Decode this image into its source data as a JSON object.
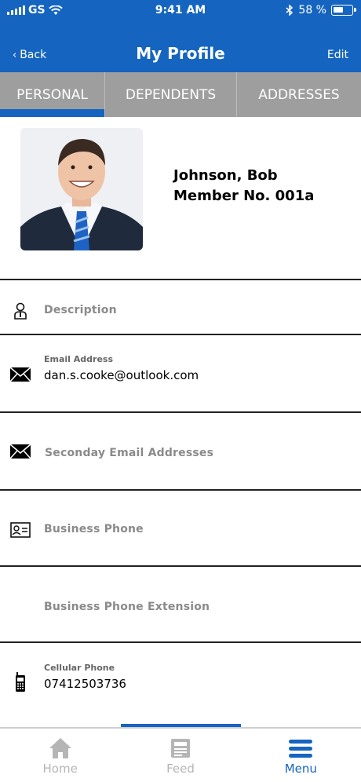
{
  "status_bar": {
    "carrier": "GS",
    "time": "9:41 AM",
    "battery_pct": "58 %",
    "battery_level": 0.58
  },
  "nav": {
    "back_label": "Back",
    "title": "My Profile",
    "edit_label": "Edit"
  },
  "tabs": [
    {
      "label": "PERSONAL",
      "active": true
    },
    {
      "label": "DEPENDENTS",
      "active": false
    },
    {
      "label": "ADDRESSES",
      "active": false
    }
  ],
  "profile": {
    "name": "Johnson, Bob",
    "member_no": "Member No. 001a"
  },
  "fields": [
    {
      "icon": "person-icon",
      "label": "",
      "placeholder": "Description",
      "value": ""
    },
    {
      "icon": "envelope-icon",
      "label": "Email Address",
      "placeholder": "",
      "value": "dan.s.cooke@outlook.com"
    },
    {
      "icon": "envelope-icon",
      "label": "",
      "placeholder": "Seconday Email Addresses",
      "value": ""
    },
    {
      "icon": "contact-card-icon",
      "label": "",
      "placeholder": "Business Phone",
      "value": ""
    },
    {
      "icon": "",
      "label": "",
      "placeholder": "Business Phone Extension",
      "value": ""
    },
    {
      "icon": "cellphone-icon",
      "label": "Cellular Phone",
      "placeholder": "",
      "value": "07412503736"
    }
  ],
  "bottom_nav": [
    {
      "label": "Home",
      "icon": "home-icon",
      "active": false
    },
    {
      "label": "Feed",
      "icon": "feed-icon",
      "active": false
    },
    {
      "label": "Menu",
      "icon": "menu-icon",
      "active": true
    }
  ],
  "colors": {
    "brand": "#1565c0",
    "tab_bg": "#9e9e9e",
    "inactive_nav": "#b5b5b5"
  }
}
